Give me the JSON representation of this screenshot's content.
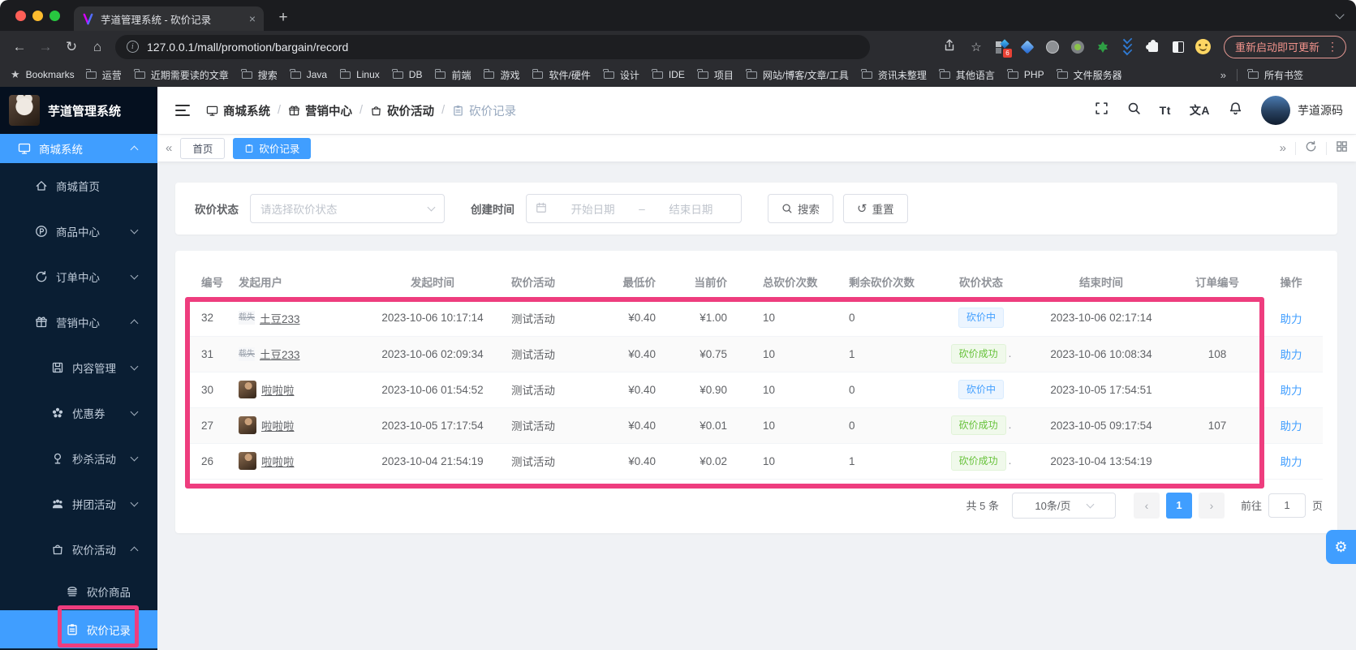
{
  "colors": {
    "accent": "#409eff",
    "annotation_pink": "#ee3d7e",
    "sidebar_bg": "#0a1e33",
    "chrome_dark": "#2b2c30",
    "badge_processing_text": "#409eff",
    "badge_success_text": "#67c23a",
    "update_pill": "#f2938c"
  },
  "browser": {
    "tab_title": "芋道管理系统 - 砍价记录",
    "url": "127.0.0.1/mall/promotion/bargain/record",
    "extension_badge": "6",
    "update_pill": "重新启动即可更新",
    "bookmarks_bar": {
      "label": "Bookmarks",
      "folders": [
        "运营",
        "近期需要读的文章",
        "搜索",
        "Java",
        "Linux",
        "DB",
        "前端",
        "游戏",
        "软件/硬件",
        "设计",
        "IDE",
        "项目",
        "网站/博客/文章/工具",
        "资讯未整理",
        "其他语言",
        "PHP",
        "文件服务器"
      ],
      "overflow": "»",
      "all_bookmarks": "所有书签"
    }
  },
  "app": {
    "logo_title": "芋道管理系统",
    "header": {
      "breadcrumb": [
        {
          "label": "商城系统",
          "icon": "monitor"
        },
        {
          "label": "营销中心",
          "icon": "gift"
        },
        {
          "label": "砍价活动",
          "icon": "bargain"
        },
        {
          "label": "砍价记录",
          "icon": "record"
        }
      ],
      "fontsize_icon_text": "Tt",
      "translate_icon_text": "文A",
      "username": "芋道源码"
    },
    "tabs": {
      "home": "首页",
      "current": "砍价记录"
    },
    "sidebar": [
      {
        "key": "mall-system",
        "label": "商城系统",
        "level": 0,
        "icon": "monitor",
        "chevron": "up",
        "active": true
      },
      {
        "key": "mall-home",
        "label": "商城首页",
        "level": 1,
        "icon": "home",
        "chevron": null,
        "active": false
      },
      {
        "key": "product-center",
        "label": "商品中心",
        "level": 1,
        "icon": "product",
        "chevron": "down",
        "active": false
      },
      {
        "key": "order-center",
        "label": "订单中心",
        "level": 1,
        "icon": "order",
        "chevron": "down",
        "active": false
      },
      {
        "key": "marketing-center",
        "label": "营销中心",
        "level": 1,
        "icon": "gift",
        "chevron": "up",
        "active": false
      },
      {
        "key": "content-management",
        "label": "内容管理",
        "level": 2,
        "icon": "content",
        "chevron": "down",
        "active": false
      },
      {
        "key": "coupon",
        "label": "优惠券",
        "level": 2,
        "icon": "coupon",
        "chevron": "down",
        "active": false
      },
      {
        "key": "seckill-activity",
        "label": "秒杀活动",
        "level": 2,
        "icon": "seckill",
        "chevron": "down",
        "active": false
      },
      {
        "key": "groupon-activity",
        "label": "拼团活动",
        "level": 2,
        "icon": "groupon",
        "chevron": "down",
        "active": false
      },
      {
        "key": "bargain-activity",
        "label": "砍价活动",
        "level": 2,
        "icon": "bargain",
        "chevron": "up",
        "active": false
      },
      {
        "key": "bargain-goods",
        "label": "砍价商品",
        "level": 3,
        "icon": "goods",
        "chevron": null,
        "active": false
      },
      {
        "key": "bargain-record",
        "label": "砍价记录",
        "level": 3,
        "icon": "record",
        "chevron": null,
        "active": true
      }
    ]
  },
  "filters": {
    "status_label": "砍价状态",
    "status_placeholder": "请选择砍价状态",
    "time_label": "创建时间",
    "start_placeholder": "开始日期",
    "range_separator": "–",
    "end_placeholder": "结束日期",
    "search_label": "搜索",
    "reset_label": "重置"
  },
  "table": {
    "broken_avatar_text": "载失",
    "headers": [
      "编号",
      "发起用户",
      "发起时间",
      "砍价活动",
      "最低价",
      "当前价",
      "总砍价次数",
      "剩余砍价次数",
      "砍价状态",
      "结束时间",
      "订单编号",
      "操作"
    ],
    "rows": [
      {
        "id": "32",
        "user": "土豆233",
        "avatar": "broken",
        "start_time": "2023-10-06 10:17:14",
        "activity": "测试活动",
        "min_price": "¥0.40",
        "current_price": "¥1.00",
        "total_count": "10",
        "remaining_count": "0",
        "status": "砍价中",
        "status_type": "processing",
        "status_suffix": "",
        "end_time": "2023-10-06 02:17:14",
        "order_no": "",
        "action": "助力"
      },
      {
        "id": "31",
        "user": "土豆233",
        "avatar": "broken",
        "start_time": "2023-10-06 02:09:34",
        "activity": "测试活动",
        "min_price": "¥0.40",
        "current_price": "¥0.75",
        "total_count": "10",
        "remaining_count": "1",
        "status": "砍价成功",
        "status_type": "success",
        "status_suffix": ".",
        "end_time": "2023-10-06 10:08:34",
        "order_no": "108",
        "action": "助力"
      },
      {
        "id": "30",
        "user": "啦啦啦",
        "avatar": "photo",
        "start_time": "2023-10-06 01:54:52",
        "activity": "测试活动",
        "min_price": "¥0.40",
        "current_price": "¥0.90",
        "total_count": "10",
        "remaining_count": "0",
        "status": "砍价中",
        "status_type": "processing",
        "status_suffix": "",
        "end_time": "2023-10-05 17:54:51",
        "order_no": "",
        "action": "助力"
      },
      {
        "id": "27",
        "user": "啦啦啦",
        "avatar": "photo",
        "start_time": "2023-10-05 17:17:54",
        "activity": "测试活动",
        "min_price": "¥0.40",
        "current_price": "¥0.01",
        "total_count": "10",
        "remaining_count": "0",
        "status": "砍价成功",
        "status_type": "success",
        "status_suffix": ".",
        "end_time": "2023-10-05 09:17:54",
        "order_no": "107",
        "action": "助力"
      },
      {
        "id": "26",
        "user": "啦啦啦",
        "avatar": "photo",
        "start_time": "2023-10-04 21:54:19",
        "activity": "测试活动",
        "min_price": "¥0.40",
        "current_price": "¥0.02",
        "total_count": "10",
        "remaining_count": "1",
        "status": "砍价成功",
        "status_type": "success",
        "status_suffix": ".",
        "end_time": "2023-10-04 13:54:19",
        "order_no": "",
        "action": "助力"
      }
    ]
  },
  "pagination": {
    "total_text": "共 5 条",
    "page_size": "10条/页",
    "current_page": "1",
    "goto_label": "前往",
    "goto_value": "1",
    "page_unit": "页"
  }
}
